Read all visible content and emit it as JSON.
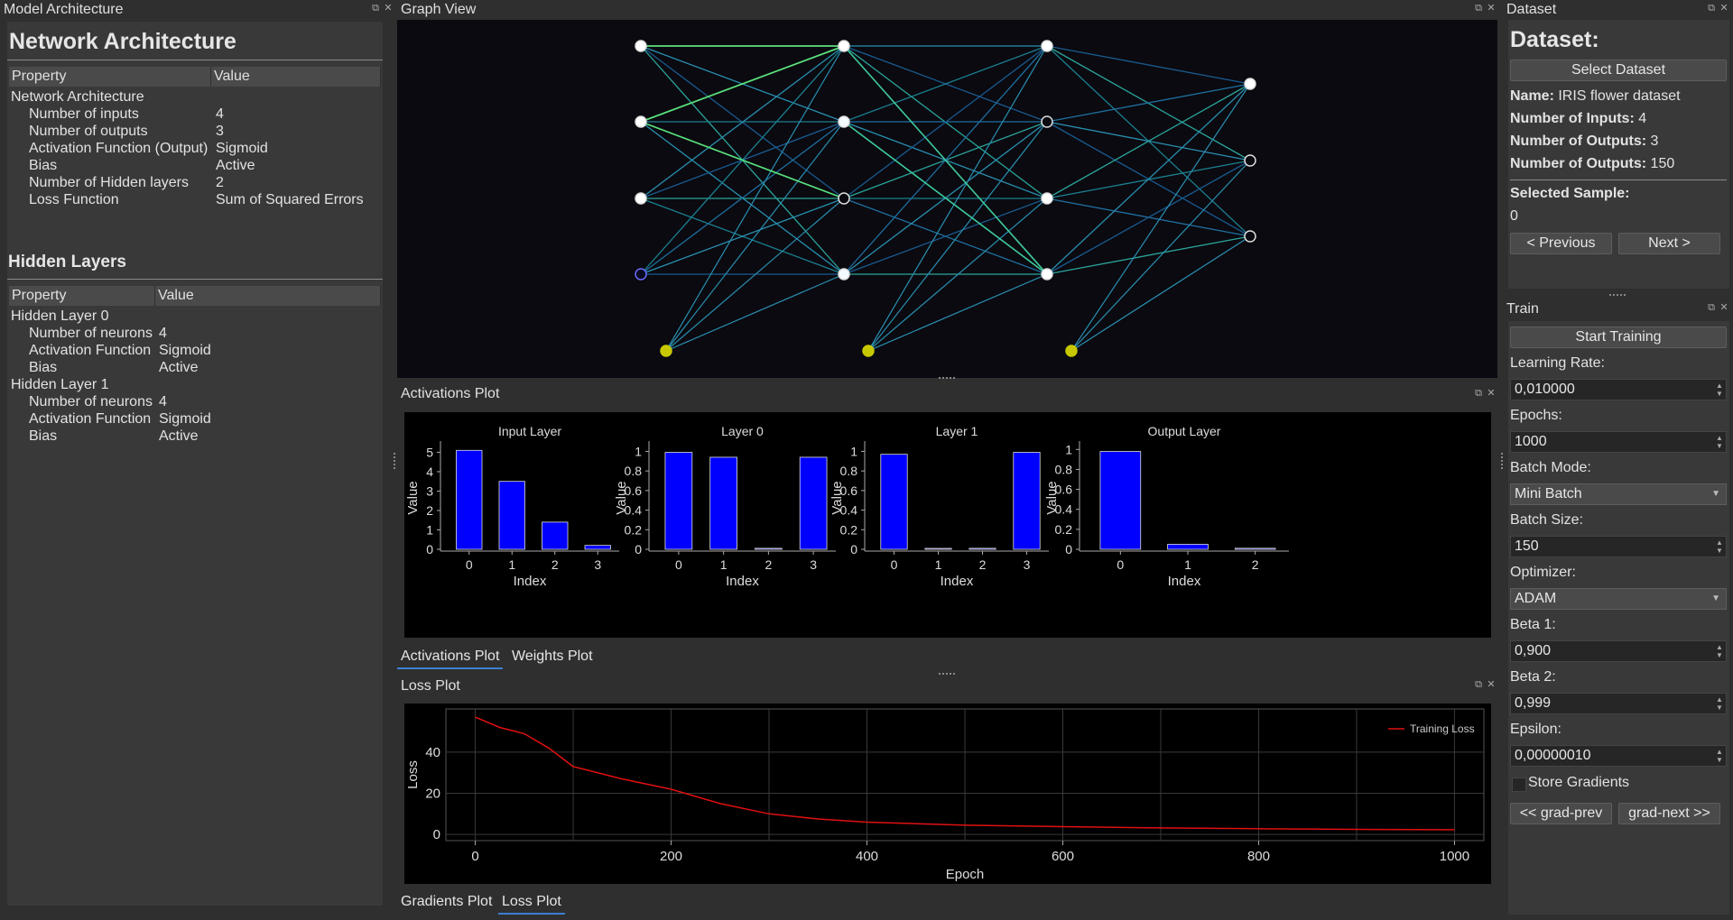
{
  "model": {
    "dock_title": "Model Architecture",
    "heading": "Network Architecture",
    "table_header": {
      "property": "Property",
      "value": "Value"
    },
    "root": "Network Architecture",
    "rows": [
      {
        "k": "Number of inputs",
        "v": "4"
      },
      {
        "k": "Number of outputs",
        "v": "3"
      },
      {
        "k": "Activation Function (Output)",
        "v": "Sigmoid"
      },
      {
        "k": "Bias",
        "v": "Active"
      },
      {
        "k": "Number of Hidden layers",
        "v": "2"
      },
      {
        "k": "Loss Function",
        "v": "Sum of Squared Errors"
      }
    ],
    "hidden_heading": "Hidden Layers",
    "hidden_header": {
      "property": "Property",
      "value": "Value"
    },
    "hidden": [
      {
        "name": "Hidden Layer 0",
        "rows": [
          {
            "k": "Number of neurons",
            "v": "4"
          },
          {
            "k": "Activation Function",
            "v": "Sigmoid"
          },
          {
            "k": "Bias",
            "v": "Active"
          }
        ]
      },
      {
        "name": "Hidden Layer 1",
        "rows": [
          {
            "k": "Number of neurons",
            "v": "4"
          },
          {
            "k": "Activation Function",
            "v": "Sigmoid"
          },
          {
            "k": "Bias",
            "v": "Active"
          }
        ]
      }
    ]
  },
  "graph_view": {
    "dock_title": "Graph View"
  },
  "activations": {
    "dock_title": "Activations Plot",
    "x_label": "Index",
    "y_label": "Value",
    "plots": [
      {
        "title": "Input Layer",
        "values": [
          5.1,
          3.5,
          1.4,
          0.2
        ],
        "yticks": [
          "0",
          "1",
          "2",
          "3",
          "4",
          "5"
        ],
        "ymax": 5.3
      },
      {
        "title": "Layer 0",
        "values": [
          0.99,
          0.94,
          0.01,
          0.94
        ],
        "yticks": [
          "0",
          "0.2",
          "0.4",
          "0.6",
          "0.8",
          "1"
        ],
        "ymax": 1.05
      },
      {
        "title": "Layer 1",
        "values": [
          0.97,
          0.0,
          0.01,
          0.99
        ],
        "yticks": [
          "0",
          "0.2",
          "0.4",
          "0.6",
          "0.8",
          "1"
        ],
        "ymax": 1.05
      },
      {
        "title": "Output Layer",
        "values": [
          0.98,
          0.05,
          0.01
        ],
        "yticks": [
          "0",
          "0.2",
          "0.4",
          "0.6",
          "0.8",
          "1"
        ],
        "ymax": 1.03
      }
    ],
    "tabs": [
      "Activations Plot",
      "Weights Plot"
    ]
  },
  "loss": {
    "dock_title": "Loss Plot",
    "x_label": "Epoch",
    "y_label": "Loss",
    "legend": "Training Loss",
    "xticks": [
      "0",
      "200",
      "400",
      "600",
      "800",
      "1000"
    ],
    "yticks": [
      "0",
      "20",
      "40"
    ],
    "tabs": [
      "Gradients Plot",
      "Loss Plot"
    ]
  },
  "chart_data": [
    {
      "type": "bar",
      "title": "Input Layer",
      "xlabel": "Index",
      "ylabel": "Value",
      "categories": [
        "0",
        "1",
        "2",
        "3"
      ],
      "values": [
        5.1,
        3.5,
        1.4,
        0.2
      ],
      "ylim": [
        0,
        5.3
      ]
    },
    {
      "type": "bar",
      "title": "Layer 0",
      "xlabel": "Index",
      "ylabel": "Value",
      "categories": [
        "0",
        "1",
        "2",
        "3"
      ],
      "values": [
        0.99,
        0.94,
        0.01,
        0.94
      ],
      "ylim": [
        0,
        1.05
      ]
    },
    {
      "type": "bar",
      "title": "Layer 1",
      "xlabel": "Index",
      "ylabel": "Value",
      "categories": [
        "0",
        "1",
        "2",
        "3"
      ],
      "values": [
        0.97,
        0.0,
        0.01,
        0.99
      ],
      "ylim": [
        0,
        1.05
      ]
    },
    {
      "type": "bar",
      "title": "Output Layer",
      "xlabel": "Index",
      "ylabel": "Value",
      "categories": [
        "0",
        "1",
        "2"
      ],
      "values": [
        0.98,
        0.05,
        0.01
      ],
      "ylim": [
        0,
        1.03
      ]
    },
    {
      "type": "line",
      "xlabel": "Epoch",
      "ylabel": "Loss",
      "series": [
        {
          "name": "Training Loss",
          "x": [
            0,
            25,
            50,
            75,
            100,
            150,
            200,
            250,
            300,
            350,
            400,
            500,
            600,
            700,
            800,
            900,
            1000
          ],
          "y": [
            57,
            52,
            49,
            42,
            33,
            27,
            22,
            15,
            10,
            7.5,
            6,
            4.5,
            3.8,
            3.2,
            2.8,
            2.5,
            2.3
          ]
        }
      ],
      "xlim": [
        -30,
        1030
      ],
      "ylim": [
        -3,
        61
      ]
    }
  ],
  "dataset": {
    "dock_title": "Dataset",
    "heading": "Dataset:",
    "select_button": "Select Dataset",
    "name_key": "Name:",
    "name_val": "IRIS flower dataset",
    "inputs_key": "Number of Inputs:",
    "inputs_val": "4",
    "outputs_key": "Number of Outputs:",
    "outputs_val": "3",
    "outputs2_key": "Number of Outputs:",
    "outputs2_val": "150",
    "sample_key": "Selected Sample:",
    "sample_val": "0",
    "prev_button": "< Previous",
    "next_button": "Next >"
  },
  "train": {
    "dock_title": "Train",
    "start_button": "Start Training",
    "lr_label": "Learning Rate:",
    "lr_value": "0,010000",
    "epochs_label": "Epochs:",
    "epochs_value": "1000",
    "batch_mode_label": "Batch Mode:",
    "batch_mode_value": "Mini Batch",
    "batch_size_label": "Batch Size:",
    "batch_size_value": "150",
    "optimizer_label": "Optimizer:",
    "optimizer_value": "ADAM",
    "beta1_label": "Beta 1:",
    "beta1_value": "0,900",
    "beta2_label": "Beta 2:",
    "beta2_value": "0,999",
    "epsilon_label": "Epsilon:",
    "epsilon_value": "0,00000010",
    "store_gradients": "Store Gradients",
    "grad_prev": "<< grad-prev",
    "grad_next": "grad-next >>"
  }
}
